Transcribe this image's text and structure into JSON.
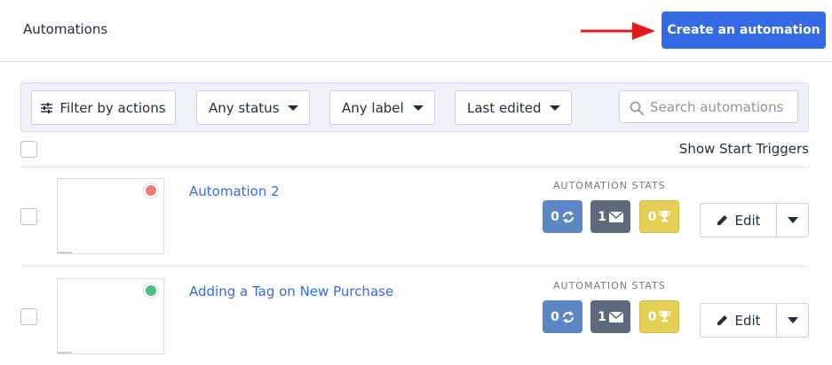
{
  "header": {
    "title": "Automations",
    "create_button": "Create an automation",
    "arrow_color": "#e01b1b"
  },
  "filters": {
    "filter_actions": "Filter by actions",
    "status": "Any status",
    "label": "Any label",
    "sort": "Last edited",
    "search_placeholder": "Search automations"
  },
  "list": {
    "show_triggers": "Show Start Triggers",
    "rows": [
      {
        "name": "Automation 2",
        "status_color": "#f07b7b",
        "stats_label": "AUTOMATION STATS",
        "stats": {
          "contacts": "0",
          "emails": "1",
          "goals": "0"
        },
        "edit_label": "Edit"
      },
      {
        "name": "Adding a Tag on New Purchase",
        "status_color": "#4cbf84",
        "stats_label": "AUTOMATION STATS",
        "stats": {
          "contacts": "0",
          "emails": "1",
          "goals": "0"
        },
        "edit_label": "Edit"
      }
    ]
  }
}
